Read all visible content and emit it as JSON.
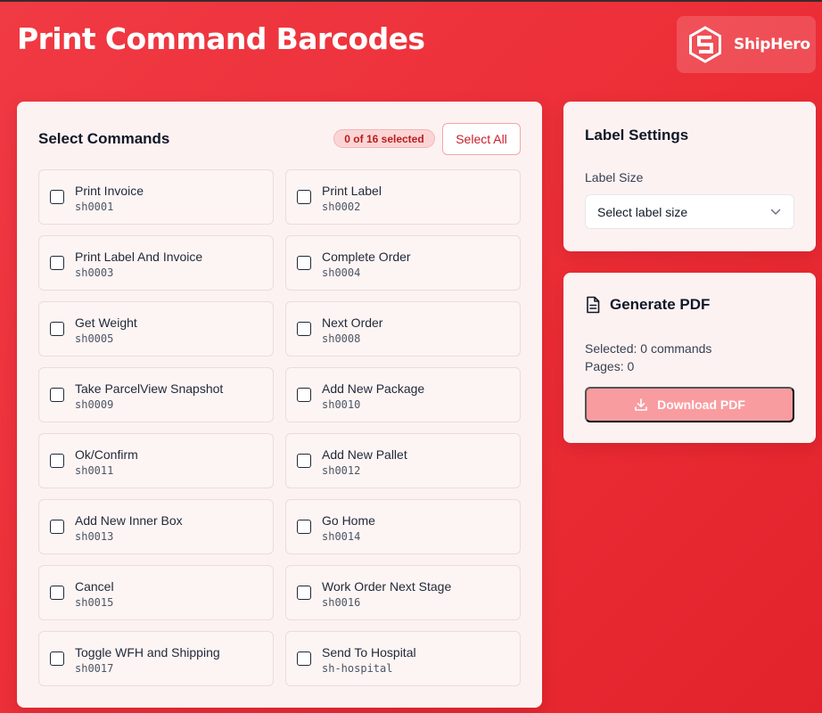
{
  "header": {
    "title": "Print Command Barcodes",
    "brand": "ShipHero"
  },
  "commands": {
    "title": "Select Commands",
    "selected_badge": "0 of 16 selected",
    "select_all_label": "Select All",
    "items": [
      {
        "name": "Print Invoice",
        "code": "sh0001"
      },
      {
        "name": "Print Label",
        "code": "sh0002"
      },
      {
        "name": "Print Label And Invoice",
        "code": "sh0003"
      },
      {
        "name": "Complete Order",
        "code": "sh0004"
      },
      {
        "name": "Get Weight",
        "code": "sh0005"
      },
      {
        "name": "Next Order",
        "code": "sh0008"
      },
      {
        "name": "Take ParcelView Snapshot",
        "code": "sh0009"
      },
      {
        "name": "Add New Package",
        "code": "sh0010"
      },
      {
        "name": "Ok/Confirm",
        "code": "sh0011"
      },
      {
        "name": "Add New Pallet",
        "code": "sh0012"
      },
      {
        "name": "Add New Inner Box",
        "code": "sh0013"
      },
      {
        "name": "Go Home",
        "code": "sh0014"
      },
      {
        "name": "Cancel",
        "code": "sh0015"
      },
      {
        "name": "Work Order Next Stage",
        "code": "sh0016"
      },
      {
        "name": "Toggle WFH and Shipping",
        "code": "sh0017"
      },
      {
        "name": "Send To Hospital",
        "code": "sh-hospital"
      }
    ]
  },
  "settings": {
    "title": "Label Settings",
    "label_size_label": "Label Size",
    "label_size_value": "Select label size"
  },
  "pdf": {
    "title": "Generate PDF",
    "selected_text": "Selected: 0 commands",
    "pages_text": "Pages: 0",
    "download_label": "Download PDF"
  },
  "colors": {
    "background": "#ec2d36",
    "accent": "#c81e2a",
    "download_button": "#f99ca0",
    "badge_bg": "#fbd5d5"
  },
  "icons": [
    "shiphero-logo-icon",
    "chevron-down-icon",
    "document-icon",
    "download-icon"
  ]
}
